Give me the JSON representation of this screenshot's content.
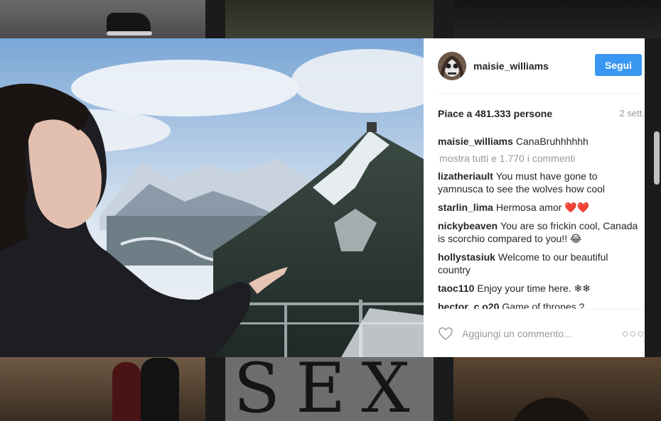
{
  "post": {
    "username": "maisie_williams",
    "follow_label": "Segui",
    "likes_text": "Piace a 481.333 persone",
    "time_ago": "2 sett.",
    "show_all_comments": "mostra tutti e 1.770 i commenti",
    "comment_placeholder": "Aggiungi un commento...",
    "more_options": "○○○"
  },
  "comments": [
    {
      "user": "maisie_williams",
      "text": "CanaBruhhhhhh"
    },
    {
      "user": "lizatheriault",
      "text": "You must have gone to yamnusca to see the wolves how cool"
    },
    {
      "user": "starlin_lima",
      "text": "Hermosa amor ❤️❤️"
    },
    {
      "user": "nickybeaven",
      "text": "You are so frickin cool, Canada is scorchio compared to you!! 😂"
    },
    {
      "user": "hollystasiuk",
      "text": "Welcome to our beautiful country"
    },
    {
      "user": "taoc110",
      "text": "Enjoy your time here. ❄❄"
    },
    {
      "user": "hector_c.o20",
      "text": "Game of thrones ?"
    }
  ],
  "background": {
    "tile_text": "SEX"
  },
  "colors": {
    "accent": "#3897f0",
    "text": "#262626",
    "muted": "#999999",
    "divider": "#efefef"
  },
  "icons": {
    "like": "heart-outline-icon",
    "more": "ellipsis-icon"
  }
}
